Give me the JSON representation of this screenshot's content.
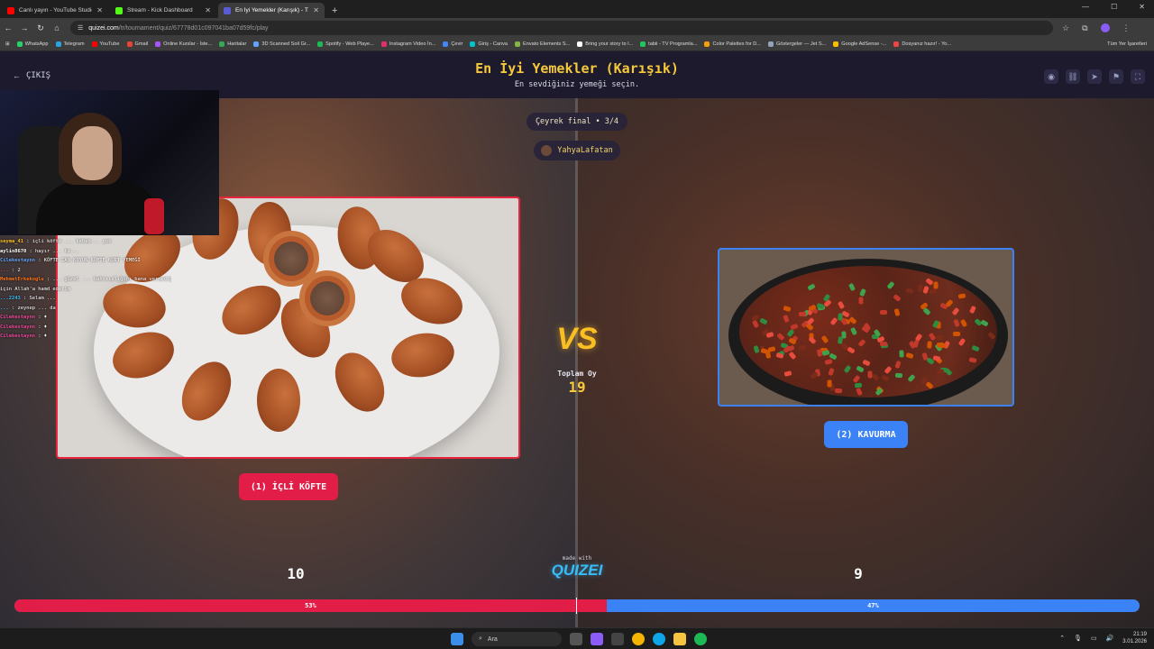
{
  "browser": {
    "tabs": [
      {
        "label": "Canlı yayın - YouTube Studio",
        "icon_color": "#ff0000"
      },
      {
        "label": "Stream - Kick Dashboard",
        "icon_color": "#53fc18"
      },
      {
        "label": "En İyi Yemekler (Karışık) - Tier L",
        "icon_color": "#5b5bd6"
      }
    ],
    "url_domain": "quizei.com",
    "url_path": "/tr/tournament/quiz/67778d01c097041ba07d59fc/play",
    "bookmarks": [
      "WhatsApp",
      "Telegram",
      "YouTube",
      "Gmail",
      "Online Kurslar - İste...",
      "Haritalar",
      "3D Scanned Soil Gr...",
      "Spotify - Web Playe...",
      "Instagram Video İn...",
      "Çevir",
      "Giriş - Canva",
      "Envato Elements S...",
      "Bring your story to l...",
      "tabii - TV Programla...",
      "Color Palettes for D...",
      "Göstergeler — Jet S...",
      "Google AdSense -...",
      "Dosyanız hazır! - Yo..."
    ],
    "bookmarks_end": "Tüm Yer İşaretleri"
  },
  "header": {
    "back_label": "ÇIKIŞ",
    "title": "En İyi Yemekler (Karışık)",
    "subtitle": "En sevdiğiniz yemeği seçin."
  },
  "round": {
    "label": "Çeyrek final • 3/4"
  },
  "user": {
    "name": "YahyaLafatan"
  },
  "chat": [
    {
      "user": "seyma_41",
      "color": "#fbbf24",
      "text": "içli köfte ... kebab... çok"
    },
    {
      "user": "aylin8670",
      "color": "#ffffff",
      "text": "hayır ... ta..."
    },
    {
      "user": "Cilekestaynn",
      "color": "#60a5fa",
      "text": "KÖFTE CAN KOYUN KÖFTE KURT YEMEĞİ"
    },
    {
      "user": "...",
      "color": "#ef4444",
      "text": "2"
    },
    {
      "user": "MehmetErkekoglu",
      "color": "#f97316",
      "text": "... güzel ... bahtsızlığını bana vermediği"
    },
    {
      "user": "",
      "color": "#ffffff",
      "text": "için Allah'a hamd ederim"
    },
    {
      "user": "...2243",
      "color": "#38bdf8",
      "text": "Selam ..."
    },
    {
      "user": "...",
      "color": "#38bdf8",
      "text": "zeynep ... da"
    },
    {
      "user": "Cilekestaynn",
      "color": "#ec4899",
      "text": "♦"
    },
    {
      "user": "Cilekestaynn",
      "color": "#ec4899",
      "text": "♦"
    },
    {
      "user": "Cilekestaynn",
      "color": "#ec4899",
      "text": "♦"
    }
  ],
  "left": {
    "button_label": "(1) İÇLİ KÖFTE",
    "votes": "10",
    "percent": "53%",
    "fraction": 0.5263
  },
  "right": {
    "button_label": "(2) KAVURMA",
    "votes": "9",
    "percent": "47%"
  },
  "total": {
    "label": "Toplam Oy",
    "value": "19"
  },
  "vs_label": "VS",
  "made_with": "made with",
  "logo": "QUIZEI",
  "taskbar": {
    "search": "Ara",
    "time": "21:19",
    "date": "3.01.2026"
  },
  "colors": {
    "left": "#e11d48",
    "right": "#3b82f6",
    "accent": "#f6c93b"
  }
}
